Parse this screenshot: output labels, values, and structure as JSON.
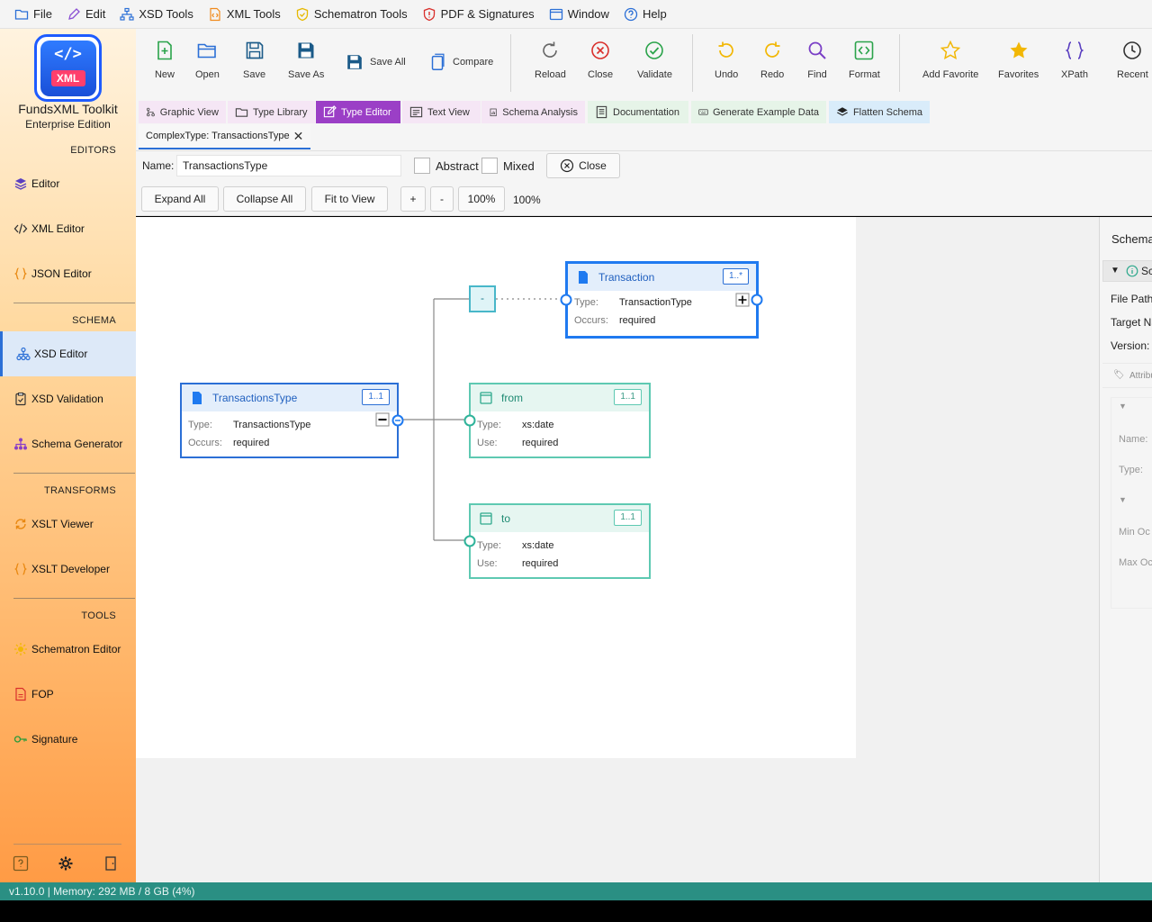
{
  "menu": [
    "File",
    "Edit",
    "XSD Tools",
    "XML Tools",
    "Schematron Tools",
    "PDF & Signatures",
    "Window",
    "Help"
  ],
  "app": {
    "logo_code": "</>",
    "logo_badge": "XML",
    "name": "FundsXML Toolkit",
    "edition": "Enterprise Edition"
  },
  "sidebar": {
    "sections": [
      "EDITORS",
      "SCHEMA",
      "TRANSFORMS",
      "TOOLS"
    ],
    "items": [
      "Editor",
      "XML Editor",
      "JSON Editor",
      "XSD Editor",
      "XSD Validation",
      "Schema Generator",
      "XSLT Viewer",
      "XSLT Developer",
      "Schematron Editor",
      "FOP",
      "Signature"
    ],
    "active": "XSD Editor"
  },
  "toolbar": {
    "new": "New",
    "open": "Open",
    "save": "Save",
    "save_as": "Save As",
    "save_all": "Save All",
    "compare": "Compare",
    "reload": "Reload",
    "close": "Close",
    "validate": "Validate",
    "undo": "Undo",
    "redo": "Redo",
    "find": "Find",
    "format": "Format",
    "add_favorite": "Add Favorite",
    "favorites": "Favorites",
    "xpath": "XPath",
    "recent": "Recent"
  },
  "view_tabs": [
    "Graphic View",
    "Type Library",
    "Type Editor",
    "Text View",
    "Schema Analysis",
    "Documentation",
    "Generate Example Data",
    "Flatten Schema"
  ],
  "active_view_tab": "Type Editor",
  "doc_tab": "ComplexType: TransactionsType",
  "type_editor": {
    "name_label": "Name:",
    "name_value": "TransactionsType",
    "abstract_label": "Abstract",
    "mixed_label": "Mixed",
    "close_label": "Close",
    "expand_all": "Expand All",
    "collapse_all": "Collapse All",
    "fit_to_view": "Fit to View",
    "zoom_in": "+",
    "zoom_out": "-",
    "zoom_reset": "100%",
    "zoom_level": "100%"
  },
  "diagram": {
    "sequence_symbol": "-",
    "type_label": "Type:",
    "occurs_label": "Occurs:",
    "use_label": "Use:",
    "root": {
      "name": "TransactionsType",
      "card": "1..1",
      "type": "TransactionsType",
      "occurs": "required"
    },
    "transaction": {
      "name": "Transaction",
      "card": "1..*",
      "type": "TransactionType",
      "occurs": "required"
    },
    "from": {
      "name": "from",
      "card": "1..1",
      "type": "xs:date",
      "use": "required"
    },
    "to": {
      "name": "to",
      "card": "1..1",
      "type": "xs:date",
      "use": "required"
    }
  },
  "right_panel": {
    "title": "Schema",
    "section": "Sc",
    "file_path": "File Path",
    "target_ns": "Target Na",
    "version": "Version:",
    "attrib": "Attribu",
    "name": "Name:",
    "type": "Type:",
    "min_occurs": "Min Oc",
    "max_occurs": "Max Oc"
  },
  "status": "v1.10.0 | Memory: 292 MB / 8 GB (4%)",
  "colors": {
    "accent": "#2b6fd6",
    "element": "#1f7af0",
    "attribute": "#5ec9b2",
    "status_bar": "#2a8f83",
    "type_editor_tab": "#9b3fc6"
  }
}
